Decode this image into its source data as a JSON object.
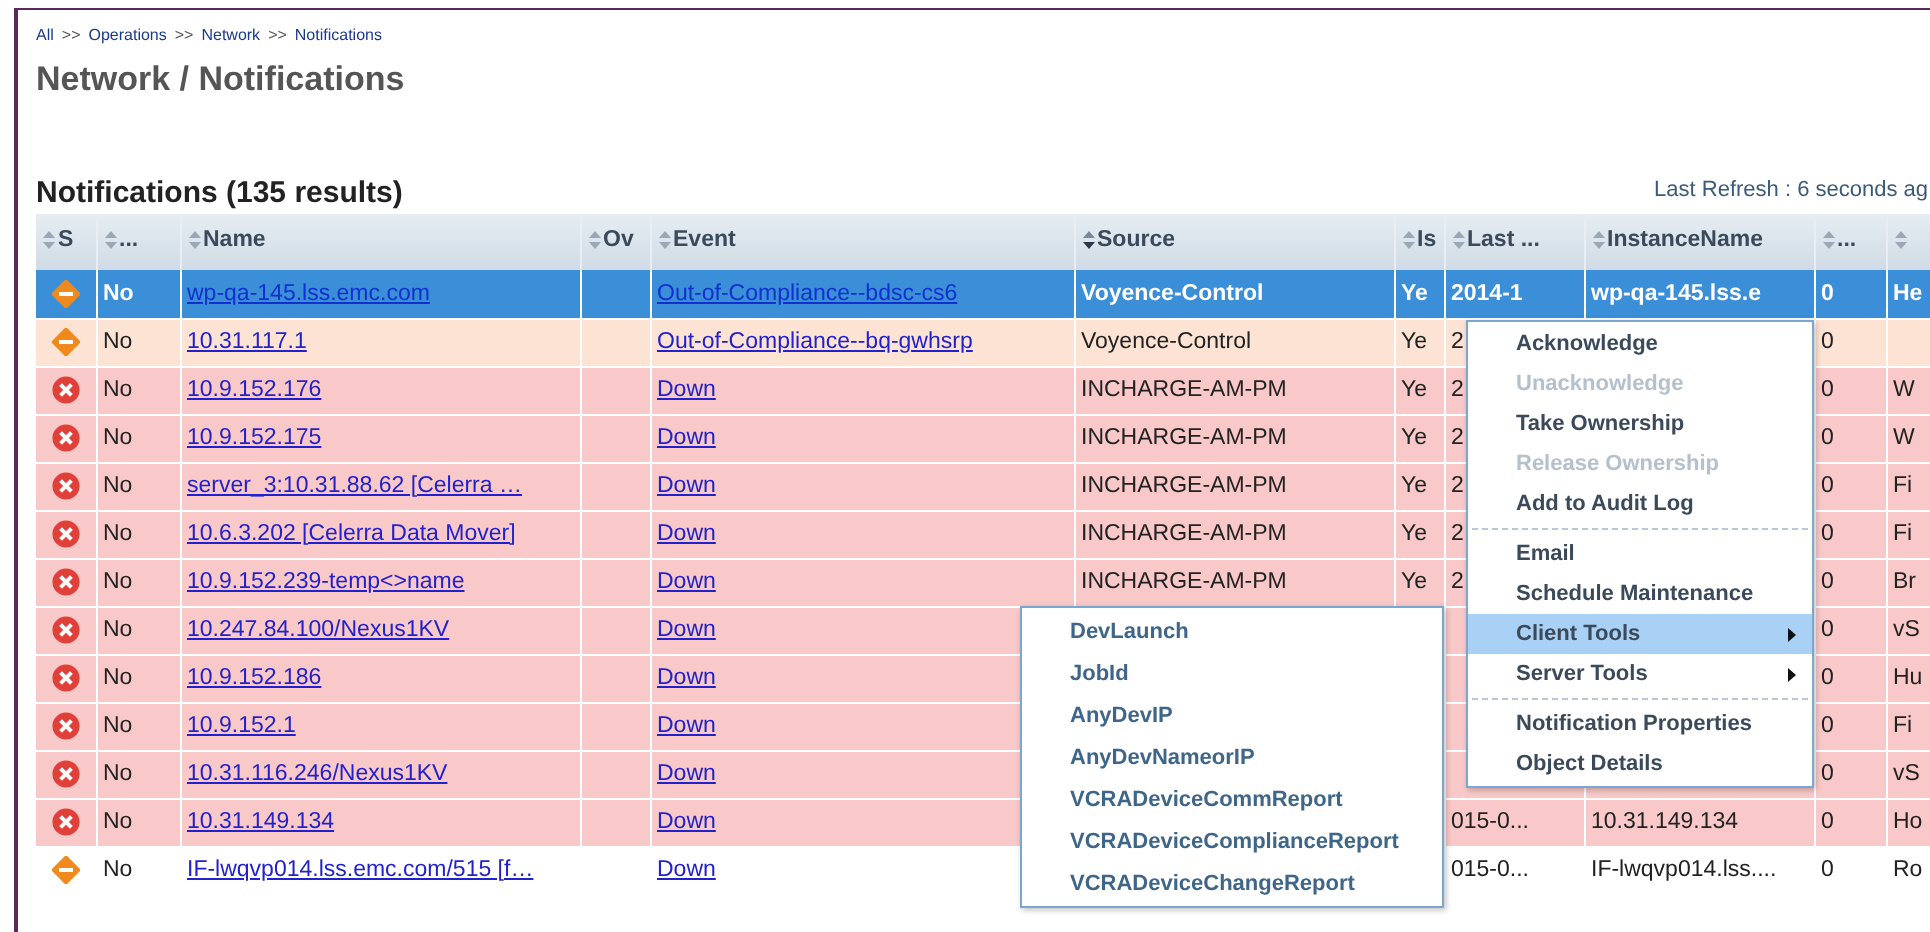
{
  "breadcrumb": {
    "separator": ">>",
    "items": [
      "All",
      "Operations",
      "Network",
      "Notifications"
    ]
  },
  "page_title": "Network / Notifications",
  "section_title": "Notifications (135 results)",
  "last_refresh": "Last Refresh : 6 seconds ag",
  "table": {
    "columns": [
      {
        "label": "S",
        "sorted": false
      },
      {
        "label": "...",
        "sorted": false
      },
      {
        "label": "Name",
        "sorted": false
      },
      {
        "label": "Ov",
        "sorted": false
      },
      {
        "label": "Event",
        "sorted": false
      },
      {
        "label": "Source",
        "sorted": true
      },
      {
        "label": "Is",
        "sorted": false
      },
      {
        "label": "Last ...",
        "sorted": false
      },
      {
        "label": "InstanceName",
        "sorted": false
      },
      {
        "label": "...",
        "sorted": false
      },
      {
        "sorted": false
      }
    ],
    "rows": [
      {
        "kind": "warning",
        "selected": true,
        "color": "#3a8fd8",
        "ack": "No",
        "name": "wp-qa-145.lss.emc.com",
        "event": "Out-of-Compliance--bdsc-cs6",
        "source": "Voyence-Control",
        "is": "Ye",
        "last": "2014-1",
        "instance": "wp-qa-145.lss.e",
        "count": "0",
        "column_11": "He"
      },
      {
        "kind": "warning",
        "selected": false,
        "color": "#fde3d3",
        "ack": "No",
        "name": "10.31.117.1",
        "event": "Out-of-Compliance--bq-gwhsrp",
        "source": "Voyence-Control",
        "is": "Ye",
        "last": "2",
        "count": "0"
      },
      {
        "kind": "critical",
        "selected": false,
        "color": "#f9c8c8",
        "ack": "No",
        "name": "10.9.152.176",
        "event": "Down",
        "source": "INCHARGE-AM-PM",
        "is": "Ye",
        "last": "2",
        "count": "0",
        "column_11": "W"
      },
      {
        "kind": "critical",
        "selected": false,
        "color": "#f9c8c8",
        "ack": "No",
        "name": "10.9.152.175",
        "event": "Down",
        "source": "INCHARGE-AM-PM",
        "is": "Ye",
        "last": "2",
        "count": "0",
        "column_11": "W"
      },
      {
        "kind": "critical",
        "selected": false,
        "color": "#f9c8c8",
        "ack": "No",
        "name": "server_3:10.31.88.62 [Celerra …",
        "event": "Down",
        "source": "INCHARGE-AM-PM",
        "is": "Ye",
        "last": "2",
        "count": "0",
        "column_11": "Fi"
      },
      {
        "kind": "critical",
        "selected": false,
        "color": "#f9c8c8",
        "ack": "No",
        "name": "10.6.3.202 [Celerra Data Mover]",
        "event": "Down",
        "source": "INCHARGE-AM-PM",
        "is": "Ye",
        "last": "2",
        "count": "0",
        "column_11": "Fi"
      },
      {
        "kind": "critical",
        "selected": false,
        "color": "#f9c8c8",
        "ack": "No",
        "name": "10.9.152.239-temp<>name",
        "event": "Down",
        "source": "INCHARGE-AM-PM",
        "is": "Ye",
        "last": "2",
        "count": "0",
        "column_11": "Br"
      },
      {
        "kind": "critical",
        "selected": false,
        "color": "#f9c8c8",
        "ack": "No",
        "name": "10.247.84.100/Nexus1KV",
        "event": "Down",
        "count": "0",
        "column_11": "vS"
      },
      {
        "kind": "critical",
        "selected": false,
        "color": "#f9c8c8",
        "ack": "No",
        "name": "10.9.152.186",
        "event": "Down",
        "count": "0",
        "column_11": "Hu"
      },
      {
        "kind": "critical",
        "selected": false,
        "color": "#f9c8c8",
        "ack": "No",
        "name": "10.9.152.1",
        "event": "Down",
        "count": "0",
        "column_11": "Fi"
      },
      {
        "kind": "critical",
        "selected": false,
        "color": "#f9c8c8",
        "ack": "No",
        "name": "10.31.116.246/Nexus1KV",
        "event": "Down",
        "count": "0",
        "column_11": "vS"
      },
      {
        "kind": "critical",
        "selected": false,
        "color": "#f9c8c8",
        "ack": "No",
        "name": "10.31.149.134",
        "event": "Down",
        "last": "015-0...",
        "instance": "10.31.149.134",
        "count": "0",
        "column_11": "Ho"
      },
      {
        "kind": "warning",
        "selected": false,
        "color": "#ffffff",
        "ack": "No",
        "name": "IF-lwqvp014.lss.emc.com/515 [f…",
        "event": "Down",
        "last": "015-0...",
        "instance": "IF-lwqvp014.lss....",
        "count": "0",
        "column_11": "Ro"
      }
    ]
  },
  "context_menu": {
    "items": [
      {
        "kind": "item",
        "label": "Acknowledge",
        "disabled": false,
        "selected": false
      },
      {
        "kind": "item",
        "label": "Unacknowledge",
        "disabled": true,
        "selected": false
      },
      {
        "kind": "item",
        "label": "Take Ownership",
        "disabled": false,
        "selected": false
      },
      {
        "kind": "item",
        "label": "Release Ownership",
        "disabled": true,
        "selected": false
      },
      {
        "kind": "item",
        "label": "Add to Audit Log",
        "disabled": false,
        "selected": false
      },
      {
        "kind": "separator"
      },
      {
        "kind": "item",
        "label": "Email",
        "disabled": false,
        "selected": false
      },
      {
        "kind": "item",
        "label": "Schedule Maintenance",
        "disabled": false,
        "selected": false
      },
      {
        "kind": "submenu",
        "label": "Client Tools",
        "disabled": false,
        "selected": true
      },
      {
        "kind": "submenu",
        "label": "Server Tools",
        "disabled": false,
        "selected": false
      },
      {
        "kind": "separator"
      },
      {
        "kind": "item",
        "label": "Notification Properties",
        "disabled": false,
        "selected": false
      },
      {
        "kind": "item",
        "label": "Object Details",
        "disabled": false,
        "selected": false
      }
    ]
  },
  "submenu": {
    "items": [
      "DevLaunch",
      "JobId",
      "AnyDevIP",
      "AnyDevNameorIP",
      "VCRADeviceCommReport",
      "VCRADeviceComplianceReport",
      "VCRADeviceChangeReport"
    ]
  }
}
